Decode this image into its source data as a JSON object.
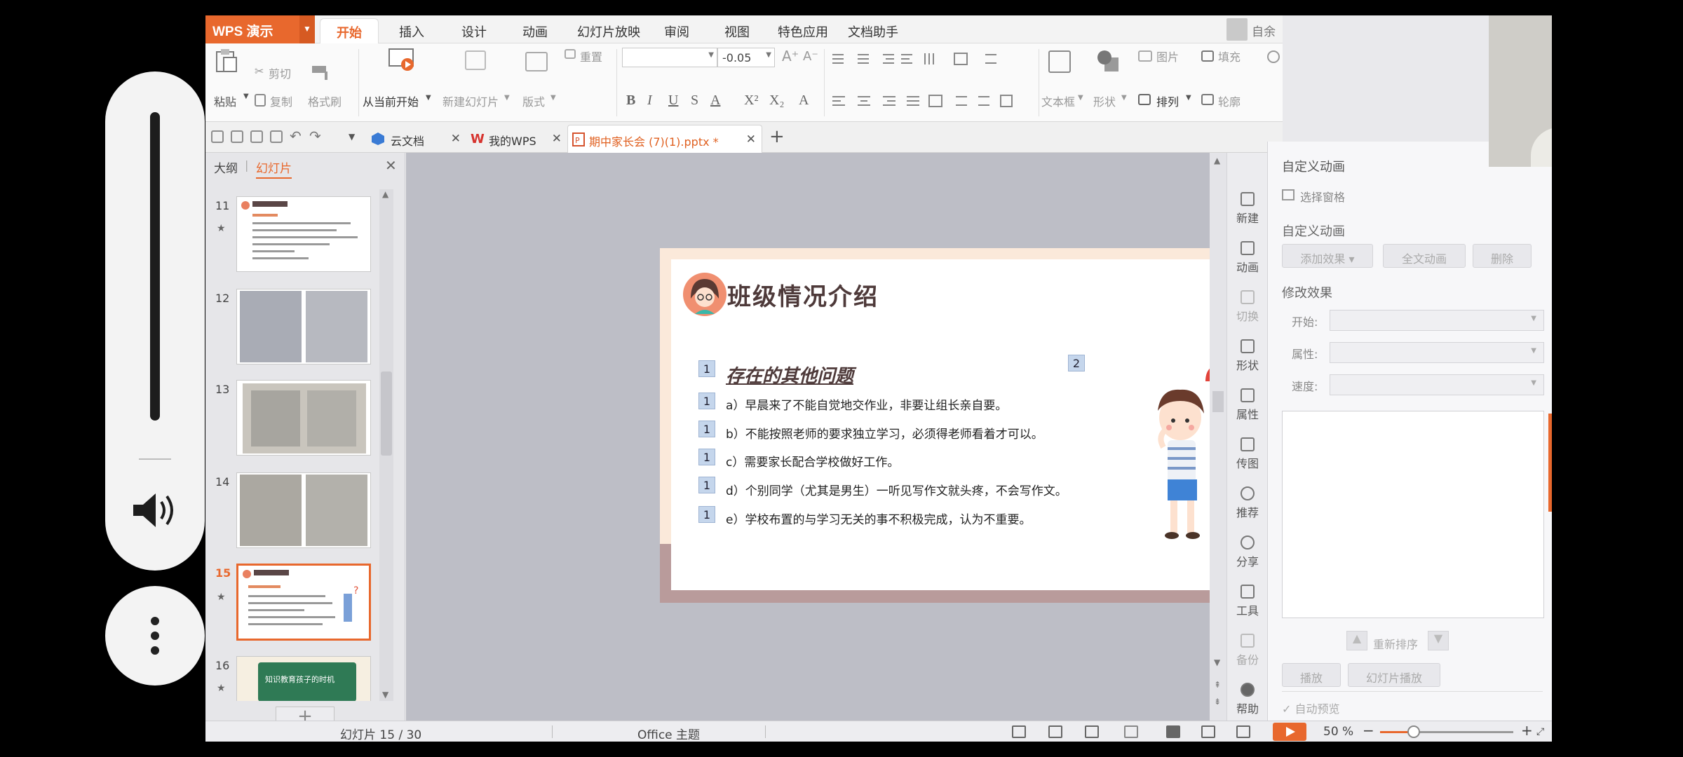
{
  "app": {
    "logo": "WPS 演示",
    "menu": [
      "开始",
      "插入",
      "设计",
      "动画",
      "幻灯片放映",
      "审阅",
      "视图",
      "特色应用",
      "文档助手"
    ],
    "user": "自余",
    "accent": "#e8682d"
  },
  "ribbon": {
    "paste": "粘贴",
    "cut": "剪切",
    "copy": "复制",
    "format_painter": "格式刷",
    "from_current": "从当前开始",
    "new_slide": "新建幻灯片",
    "layout": "版式",
    "reset": "重置",
    "font_name": "",
    "font_size": "-0.05",
    "bold": "B",
    "italic": "I",
    "underline": "U",
    "strike": "S",
    "font_color": "A",
    "superscript": "X²",
    "subscript": "X₂",
    "textbox": "文本框",
    "shape": "形状",
    "picture": "图片",
    "fill": "填充",
    "arrange": "排列",
    "outline": "轮廓"
  },
  "tabs": [
    {
      "label": "云文档",
      "icon": "cube-icon"
    },
    {
      "label": "我的WPS",
      "icon": "wps-logo-icon"
    },
    {
      "label": "期中家长会 (7)(1).pptx *",
      "icon": "presentation-file-icon",
      "active": true
    }
  ],
  "left_panel": {
    "tab_outline": "大纲",
    "tab_slides": "幻灯片",
    "slides": [
      {
        "num": "11",
        "kind": "text-slide"
      },
      {
        "num": "12",
        "kind": "photo-pages"
      },
      {
        "num": "13",
        "kind": "photo-pages"
      },
      {
        "num": "14",
        "kind": "photo-pages"
      },
      {
        "num": "15",
        "kind": "text-slide",
        "selected": true
      },
      {
        "num": "16",
        "kind": "green-board"
      }
    ],
    "thumb16_text": "知识教育孩子的时机"
  },
  "slide": {
    "title": "班级情况介绍",
    "subtitle": "存在的其他问题",
    "anim_subtitle": "1",
    "anim_image": "2",
    "bullets": [
      {
        "tag": "1",
        "text": "a）早晨来了不能自觉地交作业，非要让组长亲自要。"
      },
      {
        "tag": "1",
        "text": "b）不能按照老师的要求独立学习，必须得老师看着才可以。"
      },
      {
        "tag": "1",
        "text": "c）需要家长配合学校做好工作。"
      },
      {
        "tag": "1",
        "text": "d）个别同学（尤其是男生）一听见写作文就头疼，不会写作文。"
      },
      {
        "tag": "1",
        "text": "e）学校布置的与学习无关的事不积极完成，认为不重要。"
      }
    ]
  },
  "right_tools": [
    {
      "label": "新建",
      "icon": "new-icon",
      "dim": false
    },
    {
      "label": "动画",
      "icon": "animation-icon",
      "dim": false
    },
    {
      "label": "切换",
      "icon": "transition-icon",
      "dim": true
    },
    {
      "label": "形状",
      "icon": "shape-icon",
      "dim": false
    },
    {
      "label": "属性",
      "icon": "properties-icon",
      "dim": false
    },
    {
      "label": "传图",
      "icon": "upload-image-icon",
      "dim": false
    },
    {
      "label": "推荐",
      "icon": "recommend-icon",
      "dim": false
    },
    {
      "label": "分享",
      "icon": "share-icon",
      "dim": false
    },
    {
      "label": "工具",
      "icon": "toolbox-icon",
      "dim": false
    },
    {
      "label": "备份",
      "icon": "backup-icon",
      "dim": true
    },
    {
      "label": "帮助",
      "icon": "help-icon",
      "dim": false
    }
  ],
  "anim_pane": {
    "title": "自定义动画",
    "select_pane": "选择窗格",
    "section_custom": "自定义动画",
    "add_effect": "添加效果",
    "full_anim": "全文动画",
    "delete": "删除",
    "section_modify": "修改效果",
    "start_label": "开始:",
    "property_label": "属性:",
    "speed_label": "速度:",
    "reorder": "重新排序",
    "play": "播放",
    "slideshow": "幻灯片播放",
    "auto_preview": "自动预览"
  },
  "status": {
    "slide_pos": "幻灯片 15 / 30",
    "theme": "Office 主题",
    "zoom": "50 %",
    "zoom_fraction": 0.25
  }
}
